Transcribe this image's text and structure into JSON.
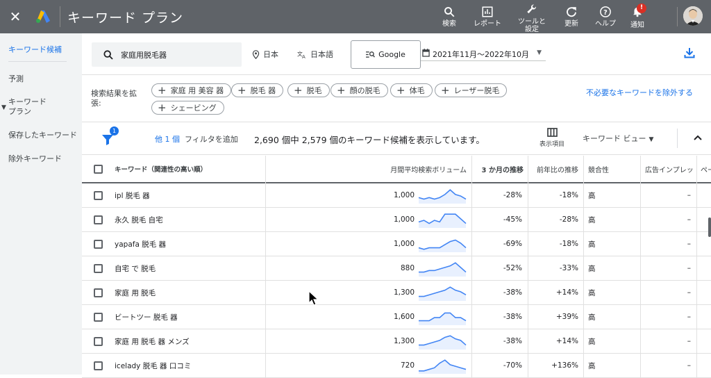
{
  "topbar": {
    "title": "キーワード プラン",
    "nav": [
      {
        "label": "検索",
        "icon": "search-icon"
      },
      {
        "label": "レポート",
        "icon": "report-icon"
      },
      {
        "label_line1": "ツールと",
        "label_line2": "設定",
        "icon": "wrench-icon"
      },
      {
        "label": "更新",
        "icon": "refresh-icon"
      },
      {
        "label": "ヘルプ",
        "icon": "help-icon"
      },
      {
        "label": "通知",
        "icon": "bell-icon",
        "badge": "!"
      }
    ]
  },
  "sidebar": {
    "items": [
      {
        "label": "キーワード候補",
        "active": true
      },
      {
        "label": "予測"
      },
      {
        "label_line1": "キーワード",
        "label_line2": "プラン"
      },
      {
        "label": "保存したキーワード"
      },
      {
        "label": "除外キーワード"
      }
    ]
  },
  "search": {
    "query": "家庭用脱毛器",
    "location": "日本",
    "language": "日本語",
    "network": "Google",
    "date_range": "2021年11月～2022年10月"
  },
  "broaden": {
    "label": "検索結果を拡張:",
    "chips": [
      "家庭 用 美容 器",
      "脱毛 器",
      "脱毛",
      "顔の脱毛",
      "体毛",
      "レーザー脱毛",
      "シェービング"
    ],
    "exclude_link": "不必要なキーワードを除外する"
  },
  "filterbar": {
    "filter_badge": "1",
    "other_filters": "他 1 個",
    "add_filter": "フィルタを追加",
    "count_text": "2,690 個中 2,579 個のキーワード候補を表示しています。",
    "columns_label": "表示項目",
    "view_label": "キーワード ビュー"
  },
  "table": {
    "headers": {
      "keyword": "キーワード（関連性の高い順）",
      "volume": "月間平均検索ボリューム",
      "three_month": "3 か月の推移",
      "yoy": "前年比の推移",
      "competition": "競合性",
      "impression_share": "広告インプレッ",
      "extra": "ペー"
    },
    "rows": [
      {
        "keyword": "ipl 脱毛 器",
        "volume": "1,000",
        "three_month": "-28%",
        "yoy": "-18%",
        "competition": "高",
        "impression": "–",
        "trend": [
          3,
          2,
          3,
          2,
          3,
          5,
          8,
          5,
          4,
          2
        ]
      },
      {
        "keyword": "永久 脱毛 自宅",
        "volume": "1,000",
        "three_month": "-45%",
        "yoy": "-28%",
        "competition": "高",
        "impression": "–",
        "trend": [
          3,
          4,
          2,
          4,
          3,
          8,
          8,
          8,
          5,
          2
        ]
      },
      {
        "keyword": "yapafa 脱毛 器",
        "volume": "1,000",
        "three_month": "-69%",
        "yoy": "-18%",
        "competition": "高",
        "impression": "–",
        "trend": [
          2,
          1,
          2,
          2,
          2,
          4,
          6,
          7,
          5,
          2
        ]
      },
      {
        "keyword": "自宅 で 脱毛",
        "volume": "880",
        "three_month": "-52%",
        "yoy": "-33%",
        "competition": "高",
        "impression": "–",
        "trend": [
          2,
          2,
          3,
          3,
          4,
          5,
          6,
          8,
          5,
          2
        ]
      },
      {
        "keyword": "家庭 用 脱毛",
        "volume": "1,300",
        "three_month": "-38%",
        "yoy": "+14%",
        "competition": "高",
        "impression": "–",
        "trend": [
          2,
          2,
          3,
          4,
          5,
          6,
          8,
          6,
          5,
          3
        ]
      },
      {
        "keyword": "ビートツー 脱毛 器",
        "volume": "1,600",
        "three_month": "-38%",
        "yoy": "+39%",
        "competition": "高",
        "impression": "–",
        "trend": [
          2,
          2,
          2,
          4,
          4,
          7,
          7,
          4,
          4,
          2
        ]
      },
      {
        "keyword": "家庭 用 脱毛 器 メンズ",
        "volume": "1,300",
        "three_month": "-38%",
        "yoy": "+14%",
        "competition": "高",
        "impression": "–",
        "trend": [
          2,
          2,
          3,
          4,
          5,
          7,
          8,
          6,
          5,
          2
        ]
      },
      {
        "keyword": "icelady 脱毛 器 口コミ",
        "volume": "720",
        "three_month": "-70%",
        "yoy": "+136%",
        "competition": "高",
        "impression": "–",
        "trend": [
          1,
          1,
          2,
          3,
          6,
          8,
          5,
          4,
          3,
          2
        ]
      }
    ]
  },
  "colors": {
    "topbar": "#5f6368",
    "accent": "#1a73e8",
    "sidebar": "#f1f3f4"
  }
}
